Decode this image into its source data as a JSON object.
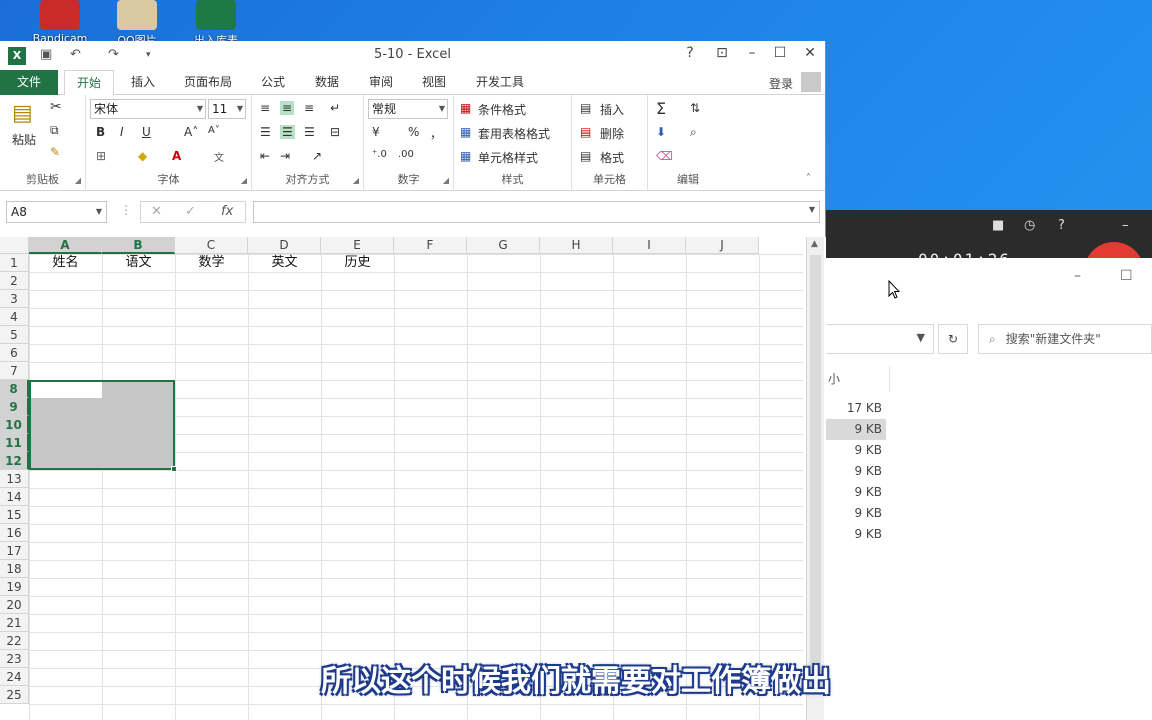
{
  "desktop": {
    "icons": [
      {
        "label": "Bandicam",
        "color": "#c92a2a"
      },
      {
        "label": "QQ图片",
        "color": "#d9c9a0"
      },
      {
        "label": "出入库表",
        "color": "#1e7a44"
      }
    ]
  },
  "recorder": {
    "timer": "00:01:26"
  },
  "explorer": {
    "search_placeholder": "搜索\"新建文件夹\"",
    "size_column": "小",
    "sizes": [
      "17 KB",
      "9 KB",
      "9 KB",
      "9 KB",
      "9 KB",
      "9 KB",
      "9 KB"
    ],
    "selected_index": 1
  },
  "excel": {
    "title": "5-10 - Excel",
    "help": "?",
    "tabs": [
      "文件",
      "开始",
      "插入",
      "页面布局",
      "公式",
      "数据",
      "审阅",
      "视图",
      "开发工具"
    ],
    "active_tab": "开始",
    "login": "登录",
    "ribbon": {
      "clipboard": {
        "label": "剪贴板",
        "paste": "粘贴"
      },
      "font": {
        "label": "字体",
        "name": "宋体",
        "size": "11",
        "bold": "B",
        "italic": "I",
        "underline": "U"
      },
      "align": {
        "label": "对齐方式"
      },
      "number": {
        "label": "数字",
        "format": "常规",
        "percent": "%",
        "comma": "，"
      },
      "styles": {
        "label": "样式",
        "cond": "条件格式",
        "table": "套用表格格式",
        "cell": "单元格样式"
      },
      "cells": {
        "label": "单元格",
        "insert": "插入",
        "delete": "删除",
        "format": "格式"
      },
      "editing": {
        "label": "编辑",
        "sum": "Σ"
      }
    },
    "namebox": "A8",
    "fx": "fx",
    "columns": [
      "A",
      "B",
      "C",
      "D",
      "E",
      "F",
      "G",
      "H",
      "I",
      "J"
    ],
    "rows": [
      "1",
      "2",
      "3",
      "4",
      "5",
      "6",
      "7",
      "8",
      "9",
      "10",
      "11",
      "12",
      "13",
      "14",
      "15",
      "16",
      "17",
      "18",
      "19",
      "20",
      "21",
      "22",
      "23",
      "24",
      "25"
    ],
    "row1": [
      "姓名",
      "语文",
      "数学",
      "英文",
      "历史"
    ],
    "selection": "A8:B12"
  },
  "subtitle": "所以这个时候我们就需要对工作簿做出"
}
